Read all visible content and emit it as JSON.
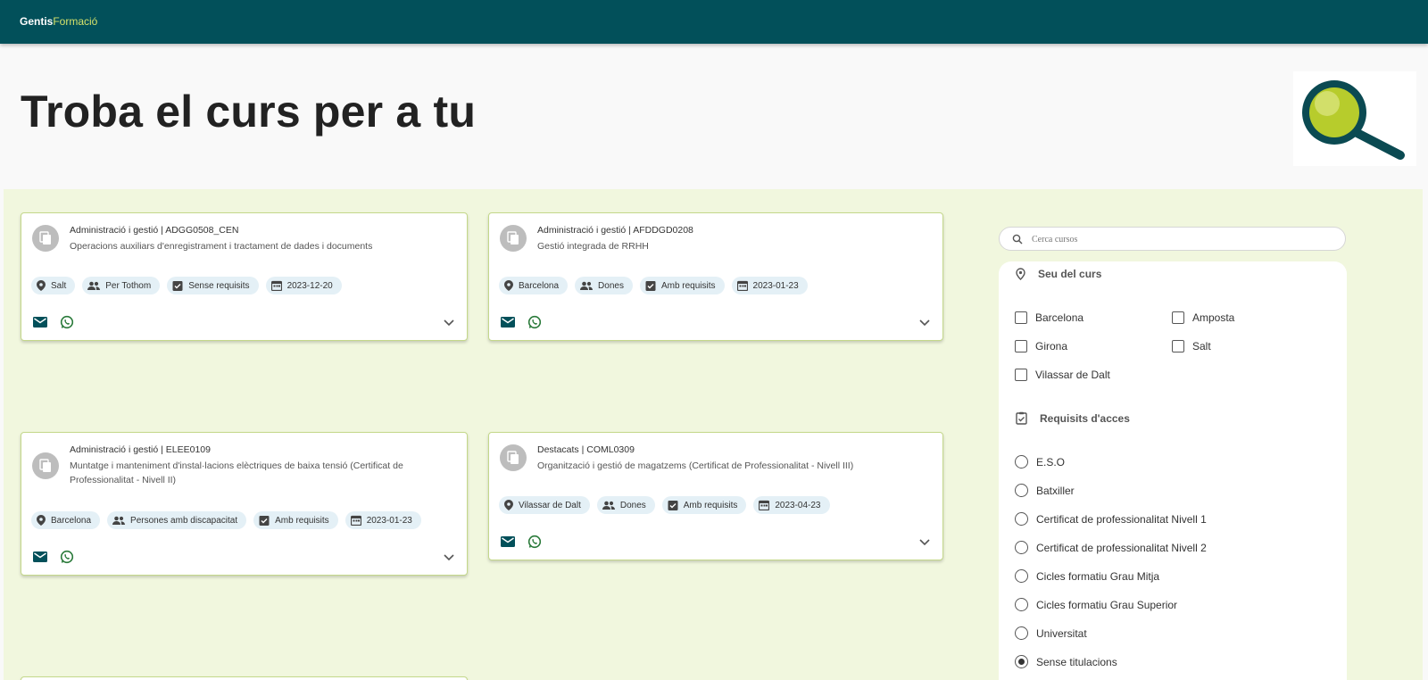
{
  "brand": {
    "part1": "Gentis",
    "part2": "Formació"
  },
  "hero": {
    "title": "Troba el curs per a tu"
  },
  "courses": [
    {
      "meta": "Administració i gestió | ADGG0508_CEN",
      "description": "Operacions auxiliars d'enregistrament i tractament de dades i documents",
      "location": "Salt",
      "audience": "Per Tothom",
      "requirements": "Sense requisits",
      "date": "2023-12-20"
    },
    {
      "meta": "Administració i gestió | AFDDGD0208",
      "description": "Gestió integrada de RRHH",
      "location": "Barcelona",
      "audience": "Dones",
      "requirements": "Amb requisits",
      "date": "2023-01-23"
    },
    {
      "meta": "Administració i gestió | ELEE0109",
      "description": "Muntatge i manteniment d'instal·lacions elèctriques de baixa tensió (Certificat de Professionalitat - Nivell II)",
      "location": "Barcelona",
      "audience": "Persones amb discapacitat",
      "requirements": "Amb requisits",
      "date": "2023-01-23"
    },
    {
      "meta": "Destacats | COML0309",
      "description": "Organització i gestió de magatzems (Certificat de Professionalitat - Nivell III)",
      "location": "Vilassar de Dalt",
      "audience": "Dones",
      "requirements": "Amb requisits",
      "date": "2023-04-23"
    }
  ],
  "search": {
    "placeholder": "Cerca cursos"
  },
  "filters": {
    "location_title": "Seu del curs",
    "locations": [
      "Barcelona",
      "Amposta",
      "Girona",
      "Salt",
      "Vilassar de Dalt"
    ],
    "requirements_title": "Requisits d'acces",
    "requirements": [
      "E.S.O",
      "Batxiller",
      "Certificat de professionalitat Nivell 1",
      "Certificat de professionalitat Nivell 2",
      "Cicles formatiu Grau Mitja",
      "Cicles formatiu Grau Superior",
      "Universitat",
      "Sense titulacions"
    ],
    "selected_requirement": "Sense titulacions"
  },
  "colors": {
    "header": "#02505a",
    "accent": "#d6e26a",
    "background": "#f1f7de",
    "chip": "#e4f0f6",
    "mail_icon": "#02505a",
    "whatsapp_icon": "#2a7a3a"
  },
  "icons": [
    "file-copy-icon",
    "location-pin-icon",
    "people-icon",
    "checklist-icon",
    "calendar-icon",
    "mail-icon",
    "whatsapp-icon",
    "chevron-down-icon",
    "search-icon",
    "magnifier-illustration"
  ]
}
